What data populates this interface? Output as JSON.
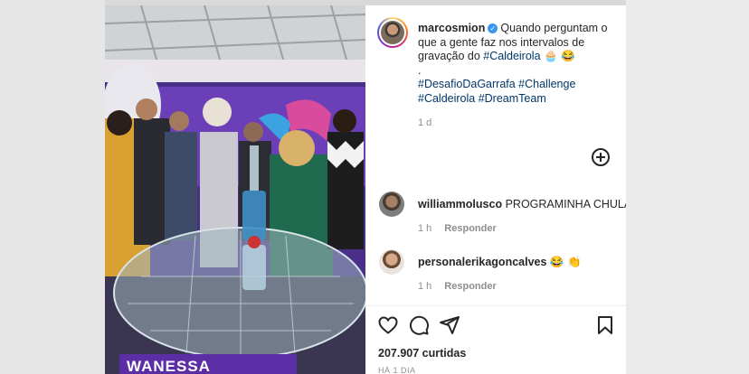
{
  "post": {
    "author": "marcosmion",
    "caption_text": "Quando perguntam o que a gente faz nos intervalos de gravação do",
    "caption_tag": "#Caldeirola",
    "caption_emoji": "🧁 😂",
    "caption_dot": ".",
    "hashtags_line1": "#DesafioDaGarrafa #Challenge",
    "hashtags_line2": "#Caldeirola #DreamTeam",
    "time": "1 d",
    "likes": "207.907 curtidas",
    "posted_ago": "HÁ 1 DIA",
    "media_overlay_text": "WANESSA"
  },
  "comments": [
    {
      "user": "williammolusco",
      "text": "PROGRAMINHA CHULA",
      "time": "1 h",
      "reply": "Responder"
    },
    {
      "user": "personalerikagoncalves",
      "text": "😂 👏",
      "time": "1 h",
      "reply": "Responder"
    }
  ],
  "icons": {
    "verified": "verified-badge-icon",
    "add": "add-comment-icon",
    "like": "heart-icon",
    "comment": "comment-bubble-icon",
    "share": "paper-plane-icon",
    "save": "bookmark-icon"
  },
  "colors": {
    "link": "#00376b",
    "verified": "#3897f0",
    "overlay": "#5b2ea6"
  }
}
